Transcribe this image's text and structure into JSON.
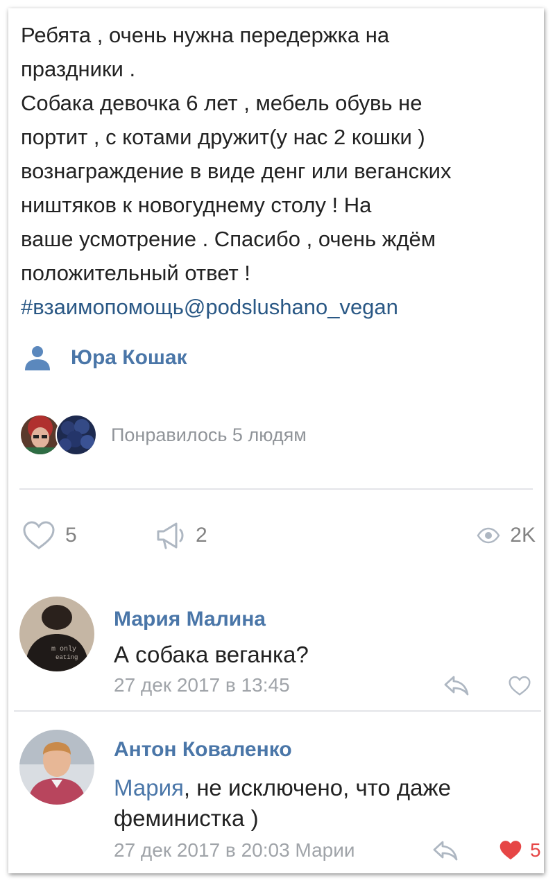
{
  "post": {
    "lines": [
      "Ребята , очень нужна передержка на",
      "праздники .",
      "Собака девочка 6 лет , мебель обувь не",
      "портит , с котами дружит(у нас 2 кошки )",
      "вознаграждение в виде денг или веганских",
      "ништяков к новогуднему столу ! На",
      "ваше усмотрение . Спасибо , очень ждём",
      "положительный ответ !"
    ],
    "hashtag": "#взаимопомощь@podslushano_vegan",
    "author": "Юра Кошак",
    "liked_by": "Понравилось 5 людям",
    "likes_count": "5",
    "reposts_count": "2",
    "views_count": "2K"
  },
  "icons": {
    "author": "user-icon",
    "like": "heart-outline-icon",
    "share": "megaphone-icon",
    "views": "eye-icon",
    "reply": "reply-arrow-icon",
    "liked": "heart-filled-icon"
  },
  "colors": {
    "link": "#4a76a8",
    "hashtag": "#2a5885",
    "muted": "#909499",
    "icon": "#aeb7c2",
    "liked": "#e64646"
  },
  "comments": [
    {
      "name": "Мария Малина",
      "reply_to": "",
      "text": "А собака веганка?",
      "text_line2": "",
      "meta": "27 дек 2017 в 13:45",
      "likes": ""
    },
    {
      "name": "Антон Коваленко",
      "reply_to": "Мария",
      "text": ", не исключено, что даже",
      "text_line2": "феминистка )",
      "meta": "27 дек 2017 в 20:03 Марии",
      "likes": "5"
    }
  ]
}
